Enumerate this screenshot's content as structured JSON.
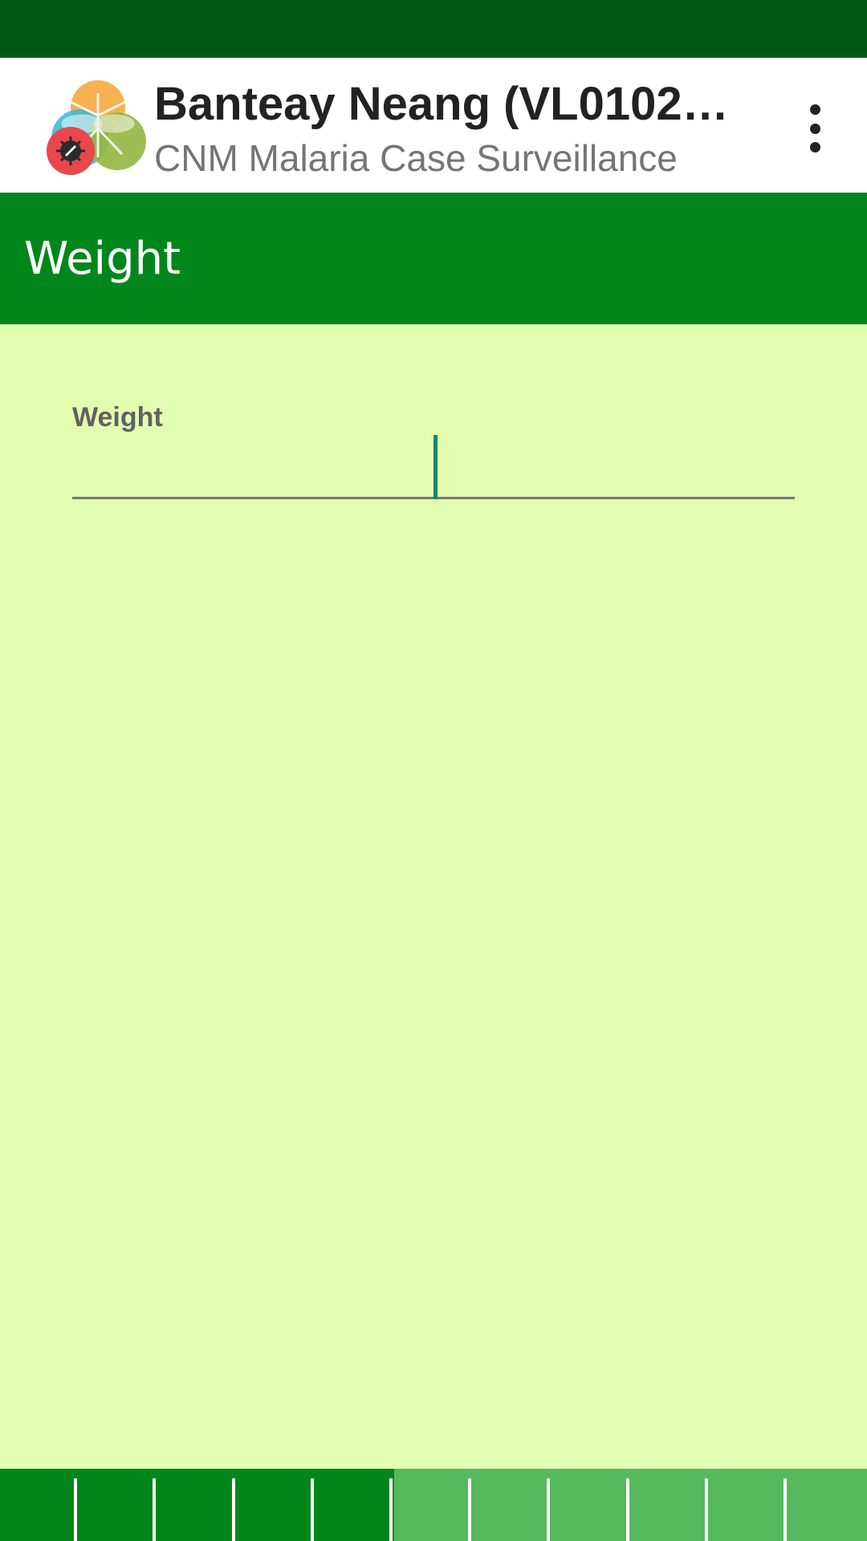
{
  "app_bar": {
    "title": "Banteay Neang (VL01020…",
    "subtitle": "CNM Malaria Case Surveillance",
    "logo_icon": "mosquito-logo-icon",
    "menu_icon": "more-vert-icon"
  },
  "section": {
    "title": "Weight"
  },
  "form": {
    "weight_label": "Weight",
    "weight_value": ""
  },
  "progress": {
    "total_steps": 11,
    "completed_steps": 5
  },
  "colors": {
    "status_bar": "#015814",
    "header_green": "#01861b",
    "progress_done": "#01861b",
    "progress_todo": "#56b85d",
    "page_background": "#e1feb0",
    "cursor": "#0a8a6a"
  }
}
